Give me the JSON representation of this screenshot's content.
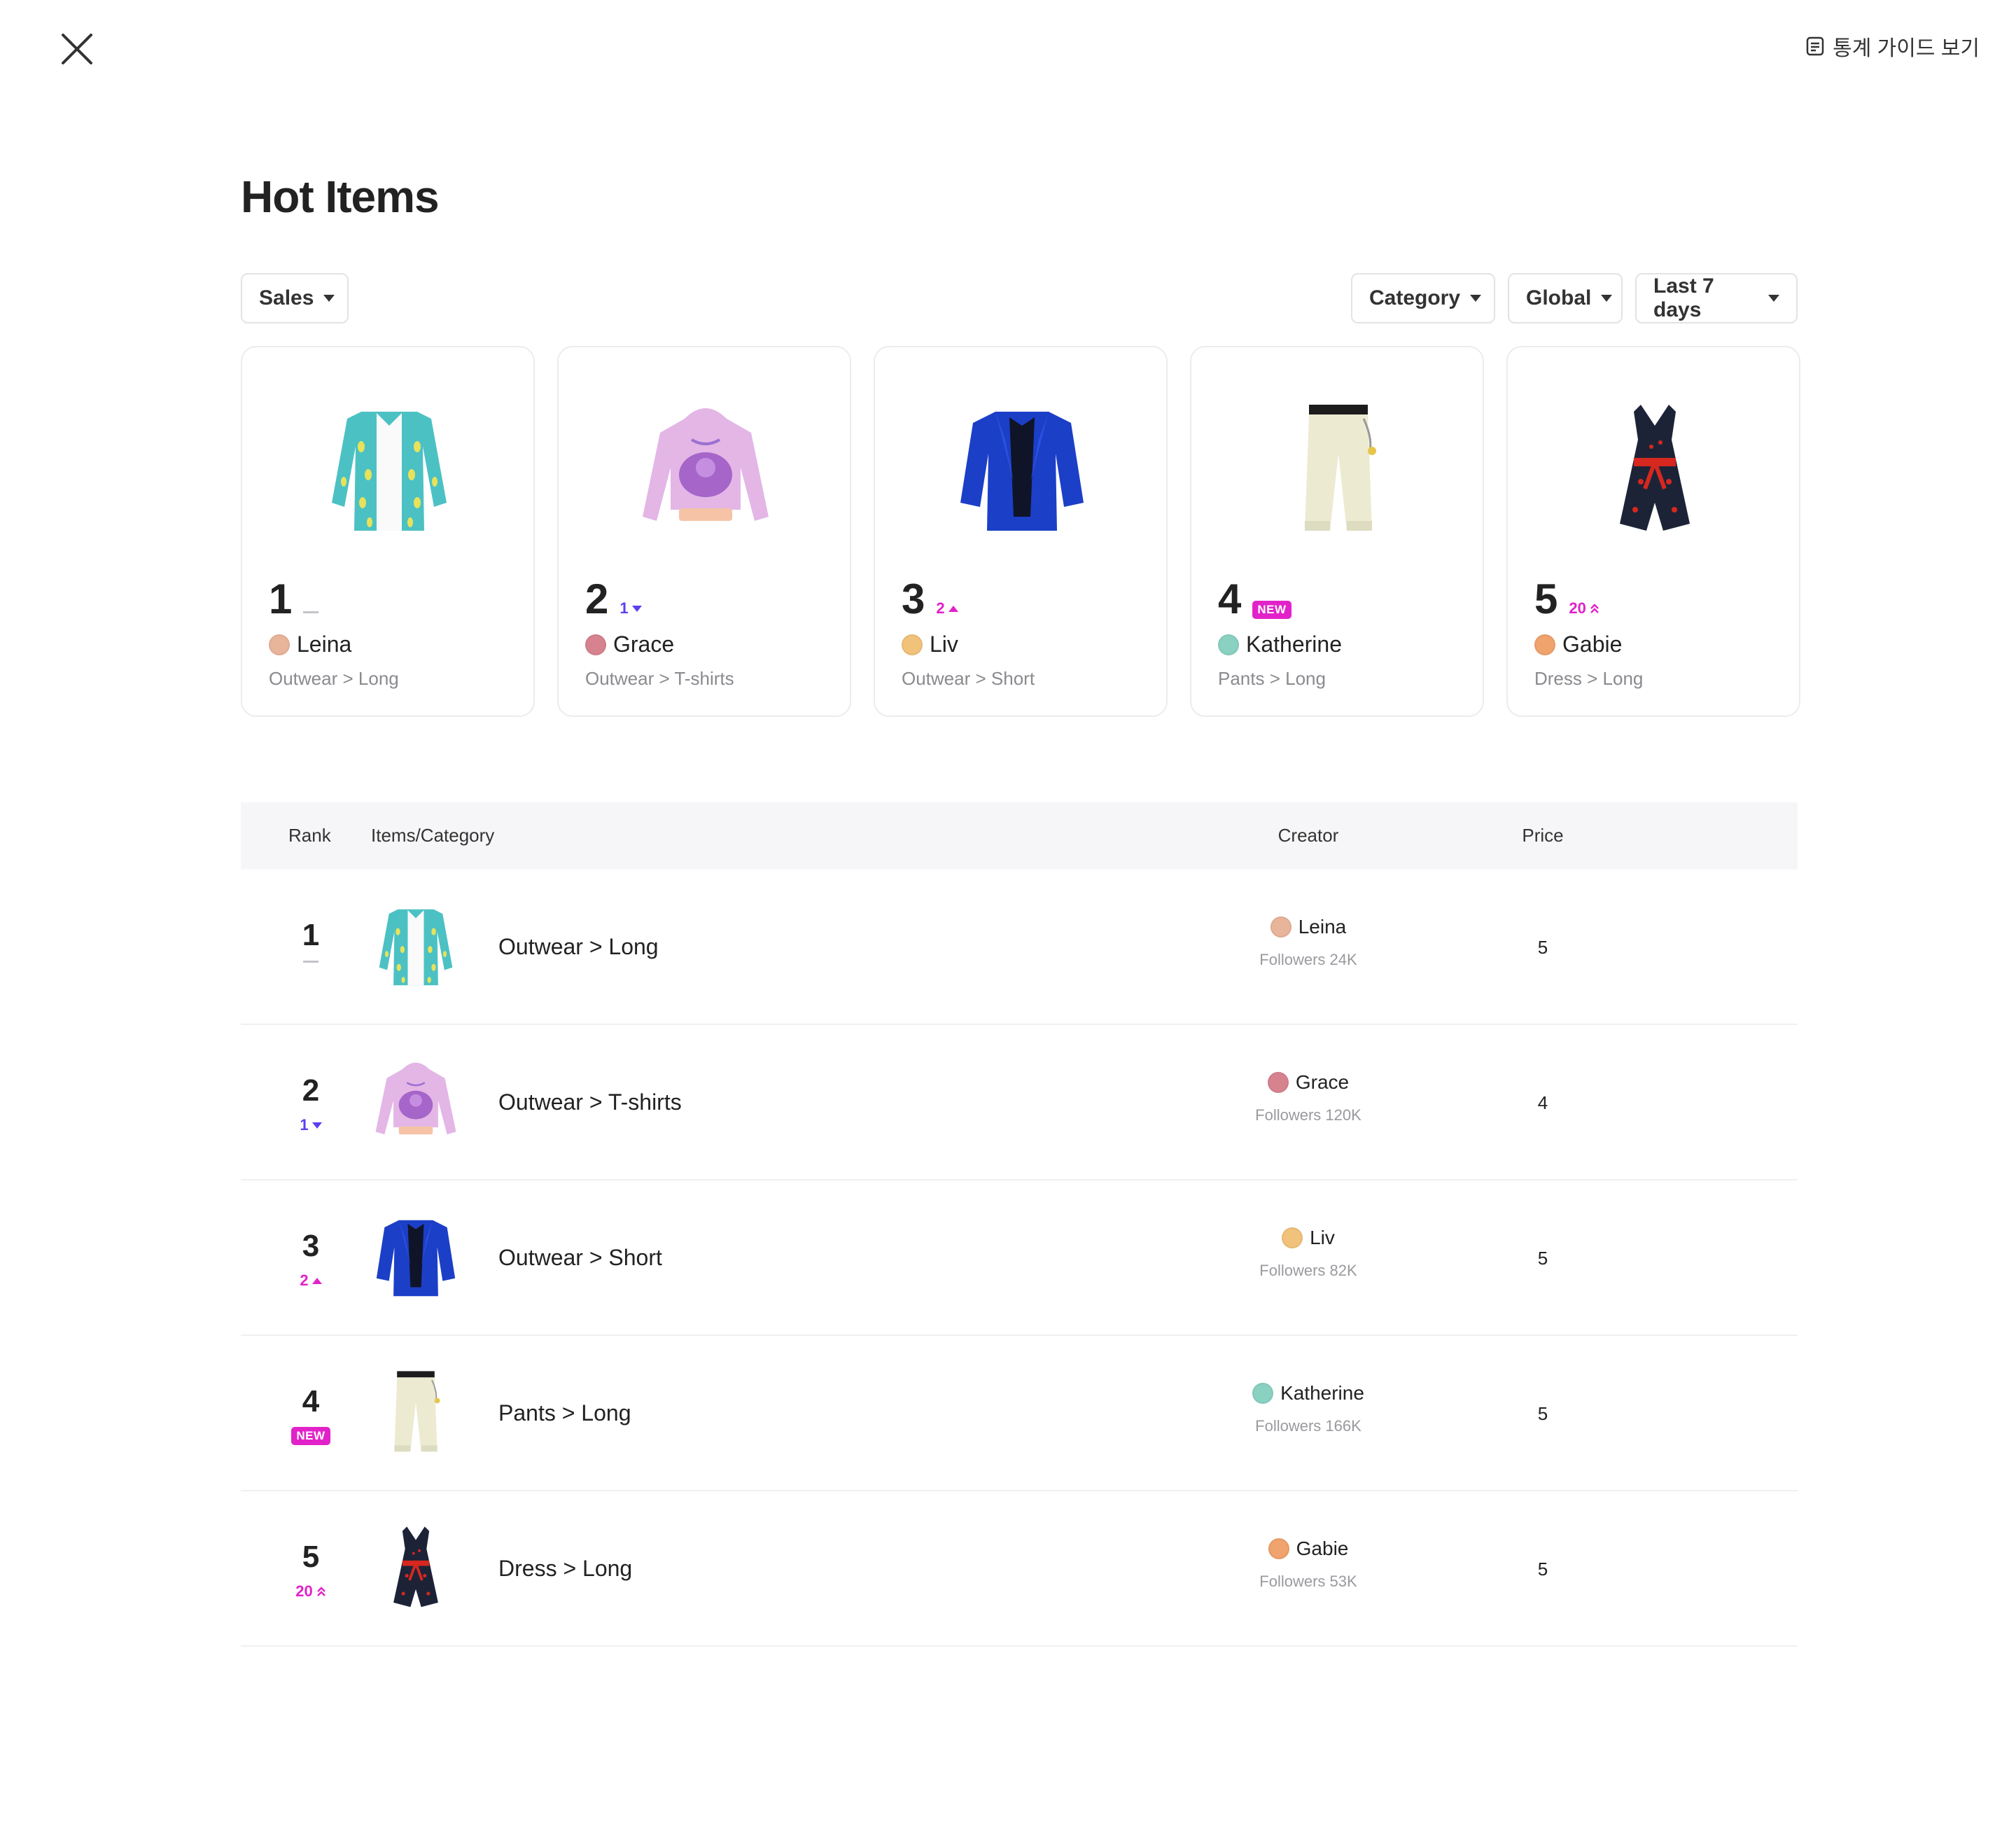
{
  "header": {
    "guide_label": "통계 가이드 보기"
  },
  "page_title": "Hot Items",
  "filters": {
    "sort": "Sales",
    "category": "Category",
    "region": "Global",
    "period": "Last 7 days"
  },
  "table_headers": {
    "rank": "Rank",
    "items": "Items/Category",
    "creator": "Creator",
    "price": "Price"
  },
  "items": [
    {
      "rank": "1",
      "change": "",
      "change_type": "same",
      "creator": "Leina",
      "category": "Outwear > Long",
      "followers": "Followers 24K",
      "price": "5",
      "avatar_color": "#e8b49a",
      "item": "teal-shirt"
    },
    {
      "rank": "2",
      "change": "1",
      "change_type": "down",
      "creator": "Grace",
      "category": "Outwear > T-shirts",
      "followers": "Followers 120K",
      "price": "4",
      "avatar_color": "#d7838f",
      "item": "lilac-hoodie"
    },
    {
      "rank": "3",
      "change": "2",
      "change_type": "up",
      "creator": "Liv",
      "category": "Outwear > Short",
      "followers": "Followers 82K",
      "price": "5",
      "avatar_color": "#f1c27a",
      "item": "blue-blazer"
    },
    {
      "rank": "4",
      "change": "NEW",
      "change_type": "new",
      "creator": "Katherine",
      "category": "Pants > Long",
      "followers": "Followers 166K",
      "price": "5",
      "avatar_color": "#8ad1c2",
      "item": "cream-pants"
    },
    {
      "rank": "5",
      "change": "20",
      "change_type": "jump",
      "creator": "Gabie",
      "category": "Dress > Long",
      "followers": "Followers 53K",
      "price": "5",
      "avatar_color": "#f0a36c",
      "item": "cherry-romper"
    }
  ],
  "colors": {
    "accent_up": "#e222c9",
    "accent_down": "#5b3ff0",
    "neutral": "#b9b9bd"
  }
}
